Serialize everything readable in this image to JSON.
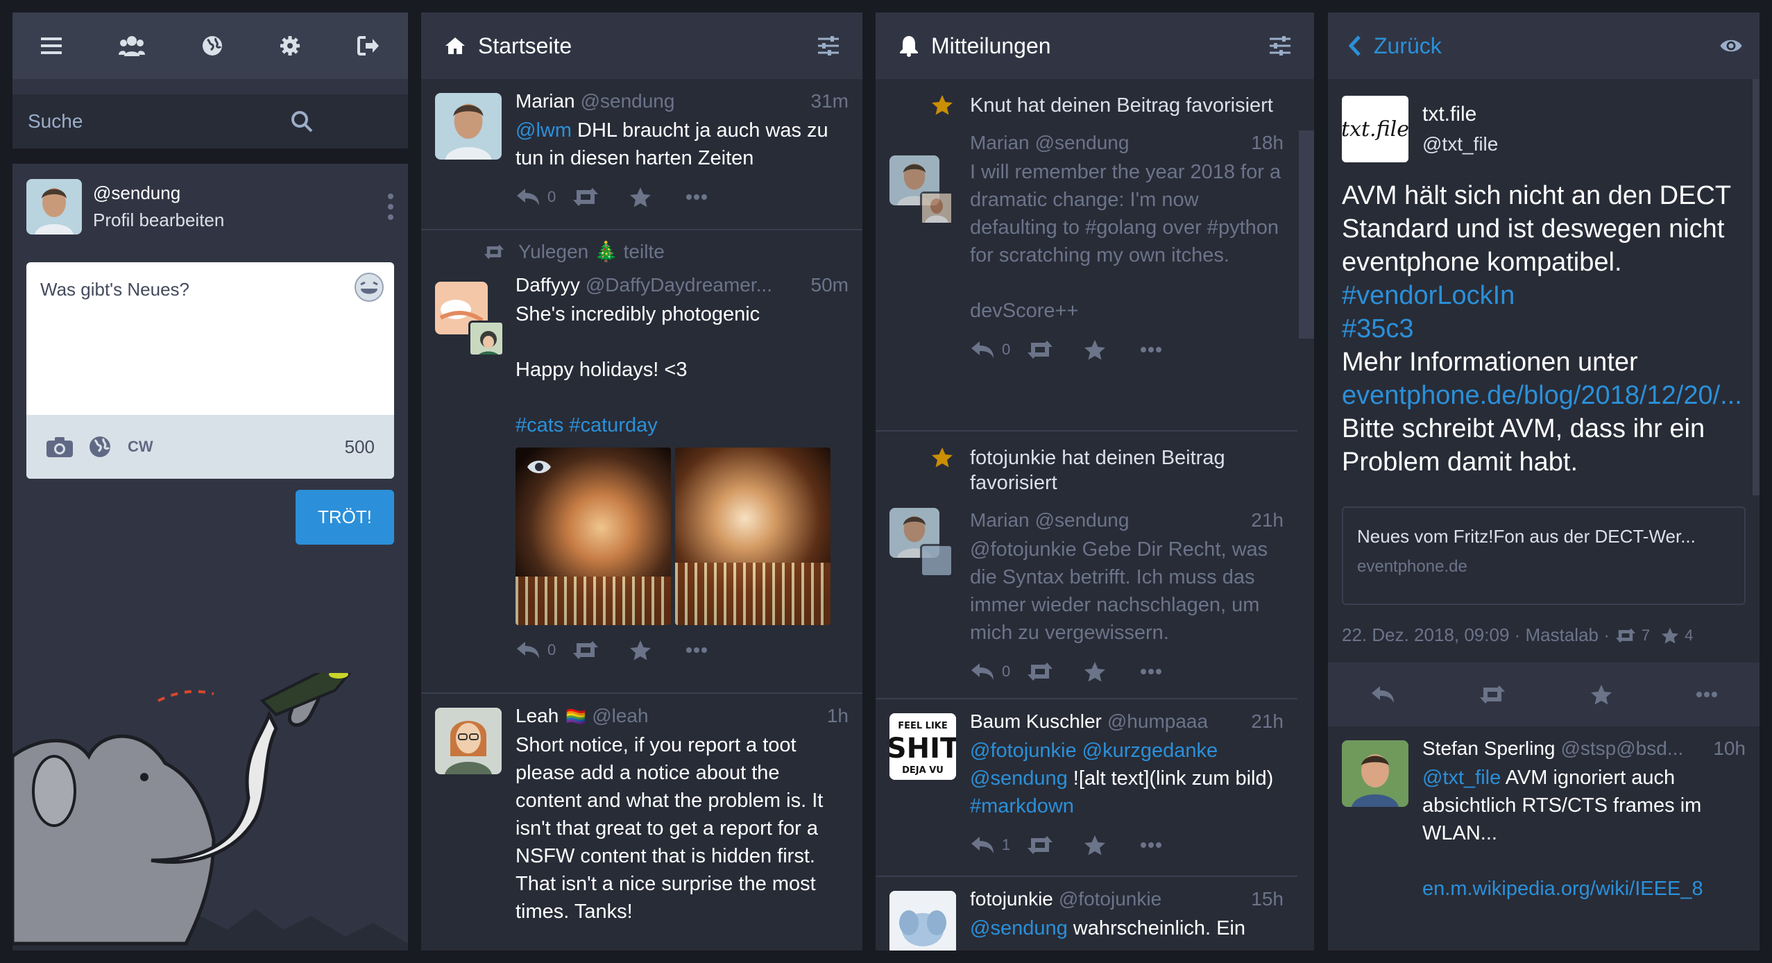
{
  "nav": {
    "icons": [
      "menu-icon",
      "people-icon",
      "globe-icon",
      "gear-icon",
      "logout-icon"
    ]
  },
  "search": {
    "placeholder": "Suche"
  },
  "profile": {
    "handle": "@sendung",
    "edit": "Profil bearbeiten"
  },
  "compose": {
    "placeholder": "Was gibt's Neues?",
    "cw": "CW",
    "count": "500",
    "button": "TRÖT!"
  },
  "home": {
    "title": "Startseite",
    "statuses": [
      {
        "name": "Marian",
        "handle": "@sendung",
        "time": "31m",
        "mention": "@lwm",
        "text": " DHL braucht ja auch was zu tun in diesen harten Zeiten",
        "replies": "0"
      },
      {
        "boost_by": "Yulegen",
        "boost_emoji": "🎄",
        "boost_text": "teilte",
        "name": "Daffyyy",
        "handle": "@DaffyDaydreamer...",
        "time": "50m",
        "p1": "She's incredibly photogenic",
        "p2": "Happy holidays! <3",
        "tags": "#cats #caturday",
        "replies": "0"
      },
      {
        "name": "Leah",
        "flag": "🏳️‍🌈",
        "handle": "@leah",
        "time": "1h",
        "text": "Short notice, if you report a toot please add a notice about the content and what the problem is. It isn't that great to get a report for a NSFW content that is hidden first. That isn't a nice surprise the most times. Tanks!"
      }
    ]
  },
  "notifications": {
    "title": "Mitteilungen",
    "items": [
      {
        "label": "Knut hat deinen Beitrag favorisiert",
        "name": "Marian",
        "handle": "@sendung",
        "time": "18h",
        "text": "I will remember the year 2018 for a dramatic change: I'm now defaulting to #golang over #python for scratching my own itches.",
        "text2": "devScore++",
        "replies": "0"
      },
      {
        "label": "fotojunkie hat deinen Beitrag favorisiert",
        "name": "Marian",
        "handle": "@sendung",
        "time": "21h",
        "text": "@fotojunkie Gebe Dir Recht, was die Syntax betrifft. Ich muss das immer wieder nachschlagen, um mich zu vergewissern.",
        "replies": "0"
      },
      {
        "name": "Baum Kuschler",
        "handle": "@humpaaa",
        "time": "21h",
        "mentions": "@fotojunkie @kurzgedanke",
        "mention2": "@sendung",
        "text": " ![alt text](link zum bild) ",
        "tag": "#markdown",
        "replies": "1",
        "avatar_text": "FEEL LIKE SHIT DEJA VU"
      },
      {
        "name": "fotojunkie",
        "handle": "@fotojunkie",
        "time": "15h",
        "mention": "@sendung",
        "text": " wahrscheinlich. Ein"
      }
    ]
  },
  "detail": {
    "back": "Zurück",
    "account_name": "txt.file",
    "account_handle": "@txt_file",
    "logo": "txt.file",
    "text1": "AVM hält sich nicht an den DECT Standard und ist deswegen nicht eventphone kompatibel. ",
    "tag1": "#vendorLockIn",
    "tag2": "#35c3",
    "text2": "Mehr Informationen unter",
    "link": "eventphone.de/blog/2018/12/20/...",
    "text3": "Bitte schreibt AVM, dass ihr ein Problem damit habt.",
    "card_title": "Neues vom Fritz!Fon aus der DECT-Wer...",
    "card_domain": "eventphone.de",
    "meta": "22. Dez. 2018, 09:09 · Mastalab · ",
    "boosts": "7",
    "favs": "4",
    "reply": {
      "name": "Stefan Sperling",
      "handle": "@stsp@bsd...",
      "time": "10h",
      "mention": "@txt_file",
      "text": " AVM ignoriert auch absichtlich RTS/CTS frames im WLAN...",
      "link": "en.m.wikipedia.org/wiki/IEEE_8"
    }
  }
}
